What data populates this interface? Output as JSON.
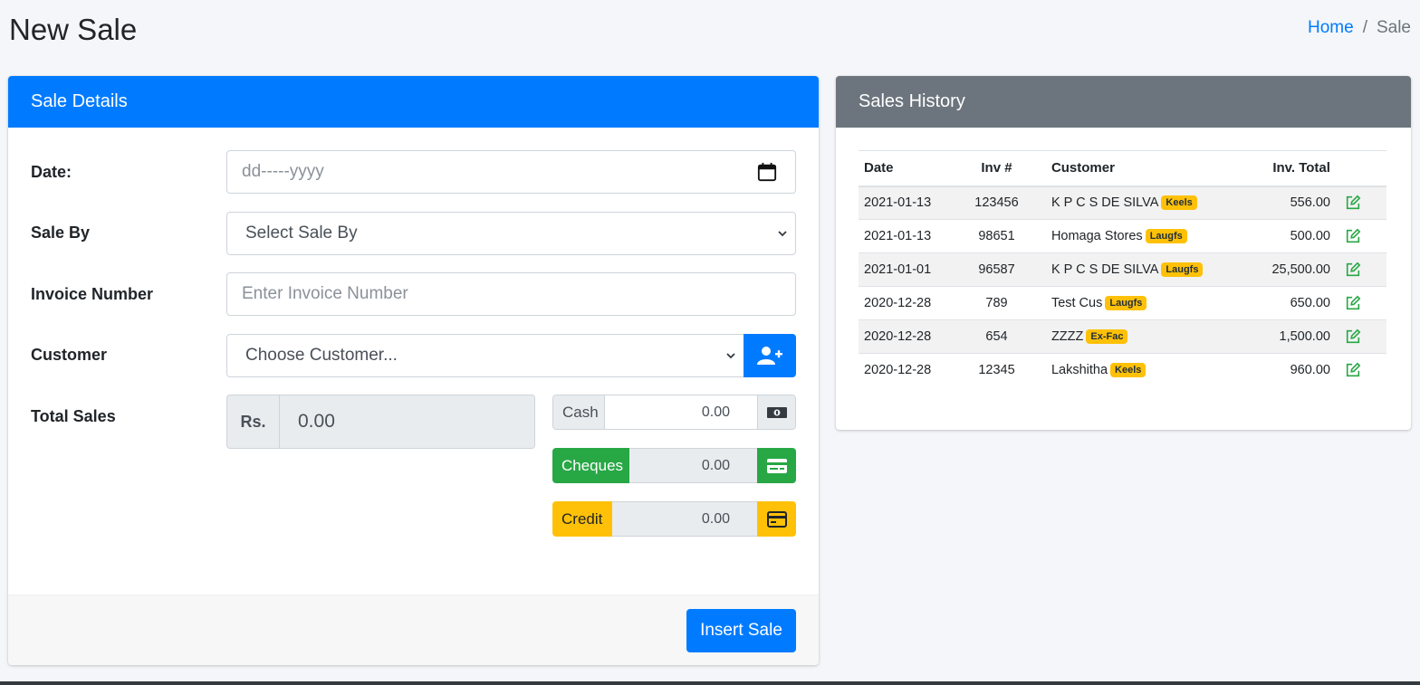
{
  "page": {
    "title": "New Sale",
    "breadcrumb": {
      "home": "Home",
      "separator": "/",
      "current": "Sale"
    }
  },
  "sale_details": {
    "header": "Sale Details",
    "date": {
      "label": "Date:",
      "placeholder": "dd-----yyyy"
    },
    "sale_by": {
      "label": "Sale By",
      "selected": "Select Sale By"
    },
    "invoice": {
      "label": "Invoice Number",
      "placeholder": "Enter Invoice Number"
    },
    "customer": {
      "label": "Customer",
      "selected": "Choose Customer..."
    },
    "total_sales": {
      "label": "Total Sales",
      "prefix": "Rs.",
      "value": "0.00"
    },
    "payments": {
      "cash": {
        "label": "Cash",
        "value": "0.00"
      },
      "cheques": {
        "label": "Cheques",
        "value": "0.00"
      },
      "credit": {
        "label": "Credit",
        "value": "0.00"
      }
    },
    "submit_label": "Insert Sale"
  },
  "sales_history": {
    "header": "Sales History",
    "columns": {
      "date": "Date",
      "inv": "Inv #",
      "customer": "Customer",
      "total": "Inv. Total"
    },
    "rows": [
      {
        "date": "2021-01-13",
        "inv": "123456",
        "customer": "K P C S DE SILVA",
        "badge": "Keels",
        "total": "556.00"
      },
      {
        "date": "2021-01-13",
        "inv": "98651",
        "customer": "Homaga Stores",
        "badge": "Laugfs",
        "total": "500.00"
      },
      {
        "date": "2021-01-01",
        "inv": "96587",
        "customer": "K P C S DE SILVA",
        "badge": "Laugfs",
        "total": "25,500.00"
      },
      {
        "date": "2020-12-28",
        "inv": "789",
        "customer": "Test Cus",
        "badge": "Laugfs",
        "total": "650.00"
      },
      {
        "date": "2020-12-28",
        "inv": "654",
        "customer": "ZZZZ",
        "badge": "Ex-Fac",
        "total": "1,500.00"
      },
      {
        "date": "2020-12-28",
        "inv": "12345",
        "customer": "Lakshitha",
        "badge": "Keels",
        "total": "960.00"
      }
    ]
  },
  "icons": {
    "calendar": "calendar-icon",
    "chevron": "chevron-down-icon",
    "add_user": "user-plus-icon",
    "money": "money-bill-icon",
    "cheque": "cheque-card-icon",
    "credit": "credit-card-icon",
    "edit": "edit-icon"
  },
  "colors": {
    "primary": "#007bff",
    "secondary": "#6c757d",
    "success": "#28a745",
    "warning": "#ffc107",
    "edit": "#28a745"
  }
}
